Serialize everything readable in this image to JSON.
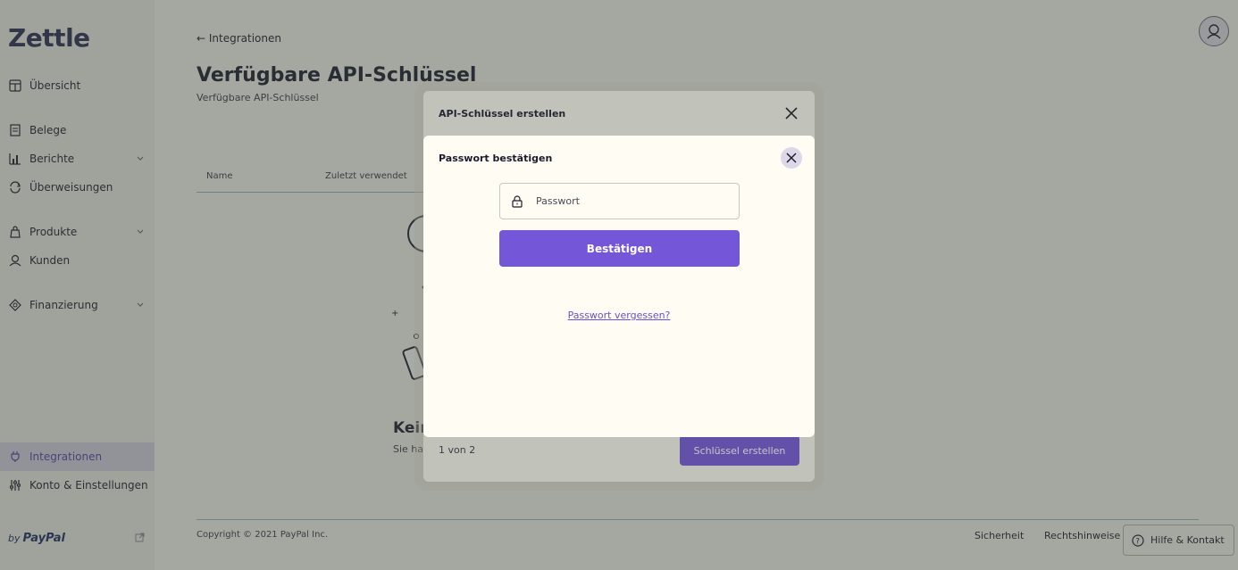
{
  "app": {
    "logo": "Zettle",
    "brand_color": "#7456d9"
  },
  "sidebar": {
    "items": [
      {
        "label": "Übersicht",
        "icon": "dashboard-icon"
      },
      {
        "label": "Belege",
        "icon": "receipt-icon"
      },
      {
        "label": "Berichte",
        "icon": "bar-chart-icon",
        "expandable": true
      },
      {
        "label": "Überweisungen",
        "icon": "transfer-icon"
      },
      {
        "label": "Produkte",
        "icon": "bag-icon",
        "expandable": true
      },
      {
        "label": "Kunden",
        "icon": "customers-icon"
      },
      {
        "label": "Finanzierung",
        "icon": "financing-icon",
        "expandable": true
      },
      {
        "label": "Integrationen",
        "icon": "plug-icon",
        "active": true
      },
      {
        "label": "Konto & Einstellungen",
        "icon": "sliders-icon"
      }
    ],
    "footer": {
      "by": "by",
      "brand": "PayPal",
      "icon": "external-link-icon"
    }
  },
  "main": {
    "back_link": "← Integrationen",
    "title": "Verfügbare API-Schlüssel",
    "subtitle": "Verfügbare API-Schlüssel",
    "table_headers": [
      "Name",
      "Zuletzt verwendet"
    ],
    "empty_title": "Kein",
    "empty_text": "Sie ha"
  },
  "footer": {
    "copyright": "Copyright ©  2021  PayPal Inc.",
    "links": [
      "Sicherheit",
      "Rechtshinweise"
    ],
    "help_label": "Hilfe & Kontakt"
  },
  "back_modal": {
    "title": "API-Schlüssel erstellen",
    "pager": "1 von 2",
    "create_button": "Schlüssel erstellen"
  },
  "front_modal": {
    "title": "Passwort bestätigen",
    "password_placeholder": "Passwort",
    "confirm_button": "Bestätigen",
    "forgot_link": "Passwort vergessen?"
  }
}
